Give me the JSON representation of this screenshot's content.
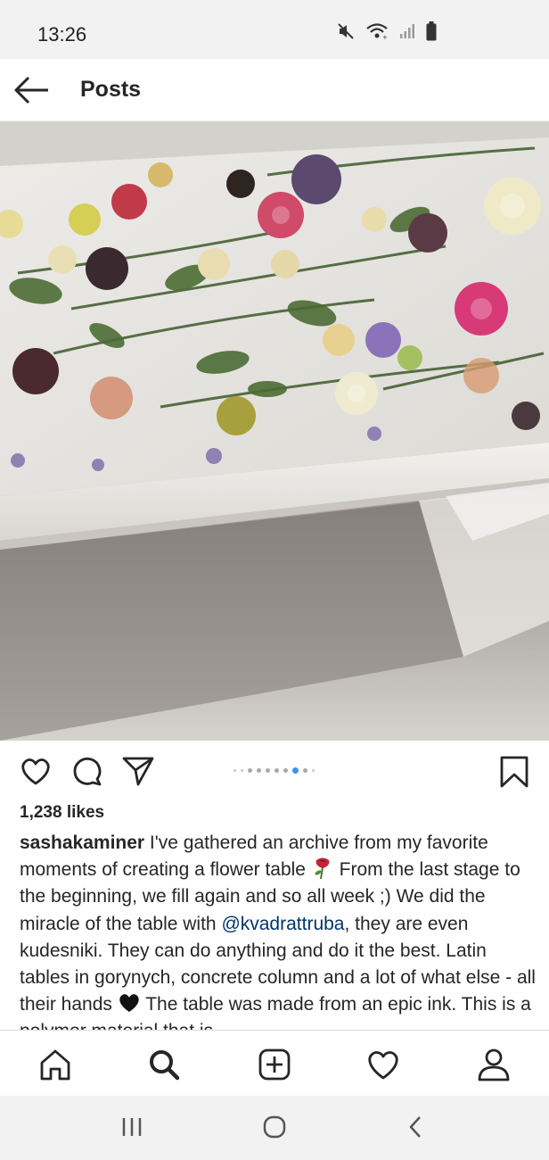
{
  "status_bar": {
    "time": "13:26",
    "icons": [
      "mute-icon",
      "wifi-icon",
      "signal-icon",
      "battery-icon"
    ]
  },
  "header": {
    "back_icon": "arrow-left-icon",
    "title": "Posts"
  },
  "post": {
    "image_description_icon": "flower-table-photo",
    "carousel": {
      "total": 10,
      "active_index": 7
    },
    "actions": {
      "like_icon": "heart-outline-icon",
      "comment_icon": "speech-bubble-icon",
      "share_icon": "paper-plane-icon",
      "save_icon": "bookmark-icon"
    },
    "likes": "1,238 likes",
    "caption": {
      "username": "sashakaminer",
      "text_1": " I've gathered an archive from my favorite moments of creating a flower table ",
      "text_2": "  From the last stage to the beginning, we fill again and so all week ;) We did the miracle of the table with ",
      "mention": "@kvadrattruba",
      "text_3": ", they are even kudesniki. They can do anything and do it the best. Latin tables in gorynych, concrete column and a lot of what else - all their hands ",
      "text_4": "  The table was made from an epic ink. This is a polymer material that is"
    }
  },
  "bottom_nav": {
    "items": [
      "home-icon",
      "search-icon",
      "add-post-icon",
      "activity-heart-icon",
      "profile-icon"
    ]
  },
  "system_nav": {
    "items": [
      "recents-icon",
      "home-circle-icon",
      "back-chevron-icon"
    ]
  },
  "colors": {
    "text": "#262626",
    "mention": "#003569",
    "carousel_active": "#3897f0",
    "system_bar": "#f2f2f2"
  }
}
